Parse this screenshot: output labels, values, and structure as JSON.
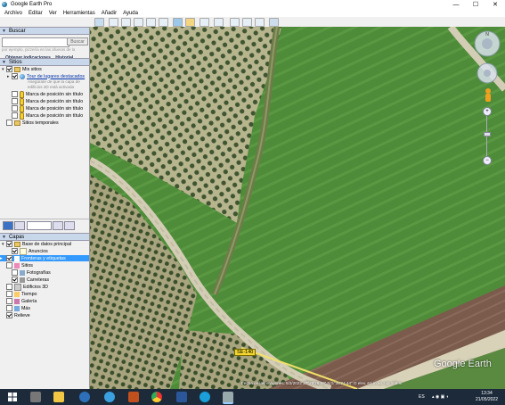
{
  "window": {
    "title": "Google Earth Pro",
    "min": "—",
    "max": "☐",
    "close": "✕"
  },
  "menu": [
    "Archivo",
    "Editar",
    "Ver",
    "Herramientas",
    "Añadir",
    "Ayuda"
  ],
  "search": {
    "header": "Buscar",
    "button": "Buscar",
    "placeholder": "",
    "hint": "por ejemplo, pizzería en las afueras de la",
    "directions_link": "Obtener indicaciones",
    "history_link": "Historial"
  },
  "places": {
    "header": "Sitios",
    "my_places": "Mis sitios",
    "tour": "Tour de lugares destacados",
    "tour_sub1": "Asegúrate de que la capa de",
    "tour_sub2": "edificios 3D está activada",
    "placemarks": [
      "Marca de posición sin título",
      "Marca de posición sin título",
      "Marca de posición sin título",
      "Marca de posición sin título"
    ],
    "temporary": "Sitios temporales"
  },
  "layers": {
    "header": "Capas",
    "primary_db": "Base de datos principal",
    "items": [
      "Anuncios",
      "Fronteras y etiquetas",
      "Sitios",
      "Fotografías",
      "Carreteras",
      "Edificios 3D",
      "Tiempo",
      "Galería",
      "Más",
      "Relieve"
    ]
  },
  "map": {
    "road_label": "SE-140",
    "status": "Fecha de las imágenes: 5/3/2022   37°25'26.58\" N  5°35'24.44\" O  elev. 61 m   alt. ojo 155 m",
    "watermark": "Google Earth",
    "scale": "250 m"
  },
  "taskbar": {
    "time": "13:34",
    "date": "21/05/2022",
    "lang": "ES"
  }
}
